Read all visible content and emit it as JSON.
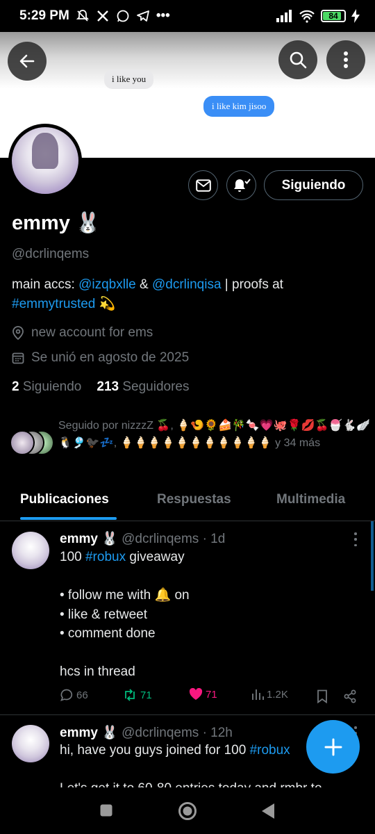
{
  "status_bar": {
    "time": "5:29 PM",
    "dots": "•••",
    "battery": "84"
  },
  "banner": {
    "bubble_left": "i like you",
    "bubble_right": "i like kim jisoo"
  },
  "profile": {
    "display_name": "emmy 🐰",
    "handle": "@dcrlinqems",
    "follow_label": "Siguiendo",
    "bio_prefix": "main accs: ",
    "bio_link1": "@izqbxlle",
    "bio_amp": " & ",
    "bio_link2": "@dcrlinqisa",
    "bio_mid": " | proofs at ",
    "bio_hashtag": "#emmytrusted",
    "bio_suffix": " 💫",
    "location": "new account for ems",
    "joined": "Se unió en agosto de 2025",
    "following_count": "2",
    "following_label": "Siguiendo",
    "followers_count": "213",
    "followers_label": "Seguidores",
    "followed_by": "Seguido por nizzzZ 🍒, 🍦🍤🌻🍰🎋🍬💗🐙🌹💋🍒🍧🐇🪽🐧🎐🐦‍⬛💤, 🍦🍦🍦🍦🍦🍦🍦🍦🍦🍦🍦 y 34 más"
  },
  "tabs": [
    "Publicaciones",
    "Respuestas",
    "Multimedia"
  ],
  "tweets": [
    {
      "name": "emmy 🐰",
      "handle_time": "@dcrlinqems · 1d",
      "text_a": "100 ",
      "hashtag": "#robux",
      "text_b": " giveaway\n\n• follow me with 🔔 on\n• like & retweet\n• comment done\n\nhcs in thread",
      "replies": "66",
      "retweets": "71",
      "likes": "71",
      "views": "1.2K"
    },
    {
      "name": "emmy 🐰",
      "handle_time": "@dcrlinqems · 12h",
      "text_a": "hi, have you guys joined for 100 ",
      "hashtag": "#robux",
      "text_b": "\n\nLet's get it to 60-80 entries today and rmbr to"
    }
  ],
  "colors": {
    "accent": "#1d9bf0",
    "like": "#f91880",
    "retweet": "#00ba7c"
  }
}
